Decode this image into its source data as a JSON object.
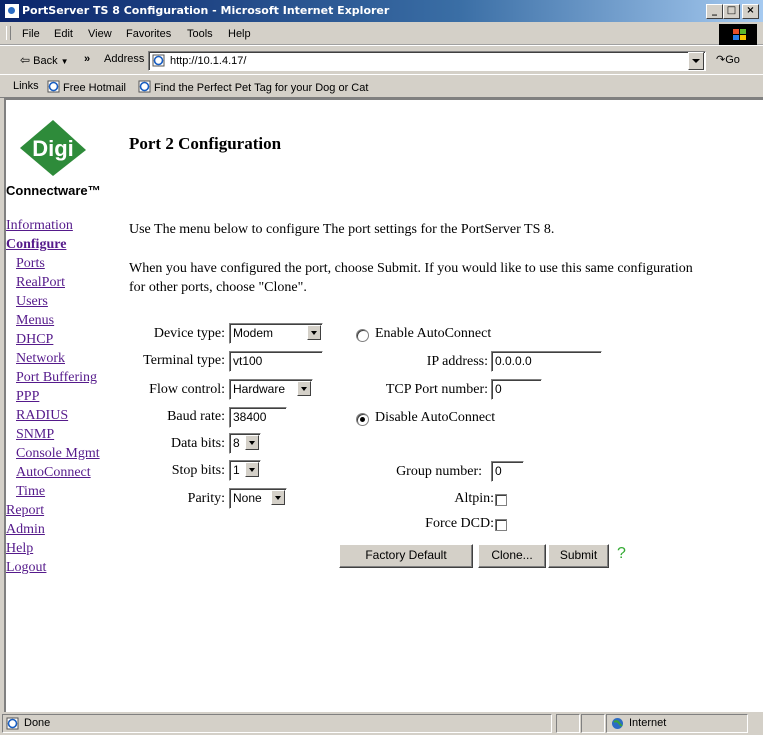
{
  "window": {
    "title": "PortServer TS 8 Configuration - Microsoft Internet Explorer"
  },
  "menu": {
    "file": "File",
    "edit": "Edit",
    "view": "View",
    "favorites": "Favorites",
    "tools": "Tools",
    "help": "Help"
  },
  "toolbar": {
    "back": "Back",
    "more": "»",
    "address_label": "Address",
    "url": "http://10.1.4.17/",
    "go": "Go"
  },
  "links": {
    "label": "Links",
    "items": [
      "Free Hotmail",
      "Find the Perfect Pet Tag for your Dog or Cat"
    ]
  },
  "logo": {
    "brand": "Digi",
    "product": "Connectware™"
  },
  "nav": {
    "information": "Information",
    "configure": "Configure",
    "sub": [
      "Ports",
      "RealPort",
      "Users",
      "Menus",
      "DHCP",
      "Network",
      "Port Buffering",
      "PPP",
      "RADIUS",
      "SNMP",
      "Console Mgmt",
      "AutoConnect",
      "Time"
    ],
    "report": "Report",
    "admin": "Admin",
    "help": "Help",
    "logout": "Logout"
  },
  "page": {
    "title": "Port 2 Configuration",
    "intro": "Use The menu below to configure The port settings for the PortServer TS 8.",
    "instructions_line1": "When you have configured the port, choose Submit. If you would like to use this same configuration",
    "instructions_line2": "for other ports, choose \"Clone\"."
  },
  "form": {
    "device_type": {
      "label": "Device type:",
      "value": "Modem"
    },
    "terminal_type": {
      "label": "Terminal type:",
      "value": "vt100"
    },
    "flow_control": {
      "label": "Flow control:",
      "value": "Hardware"
    },
    "baud_rate": {
      "label": "Baud rate:",
      "value": "38400"
    },
    "data_bits": {
      "label": "Data bits:",
      "value": "8"
    },
    "stop_bits": {
      "label": "Stop bits:",
      "value": "1"
    },
    "parity": {
      "label": "Parity:",
      "value": "None"
    },
    "enable_autoconnect": {
      "label": "Enable AutoConnect",
      "selected": false
    },
    "ip_address": {
      "label": "IP address:",
      "value": "0.0.0.0"
    },
    "tcp_port": {
      "label": "TCP Port number:",
      "value": "0"
    },
    "disable_autoconnect": {
      "label": "Disable AutoConnect",
      "selected": true
    },
    "group_number": {
      "label": "Group number:",
      "value": "0"
    },
    "altpin": {
      "label": "Altpin:",
      "checked": false
    },
    "force_dcd": {
      "label": "Force DCD:",
      "checked": false
    }
  },
  "buttons": {
    "factory_default": "Factory Default",
    "clone": "Clone...",
    "submit": "Submit",
    "help_glyph": "?"
  },
  "status": {
    "text": "Done",
    "zone": "Internet"
  },
  "colors": {
    "digi_green": "#2e8b3a",
    "visited_link": "#551a8b",
    "link": "#0000cc",
    "help_green": "#33aa33"
  }
}
